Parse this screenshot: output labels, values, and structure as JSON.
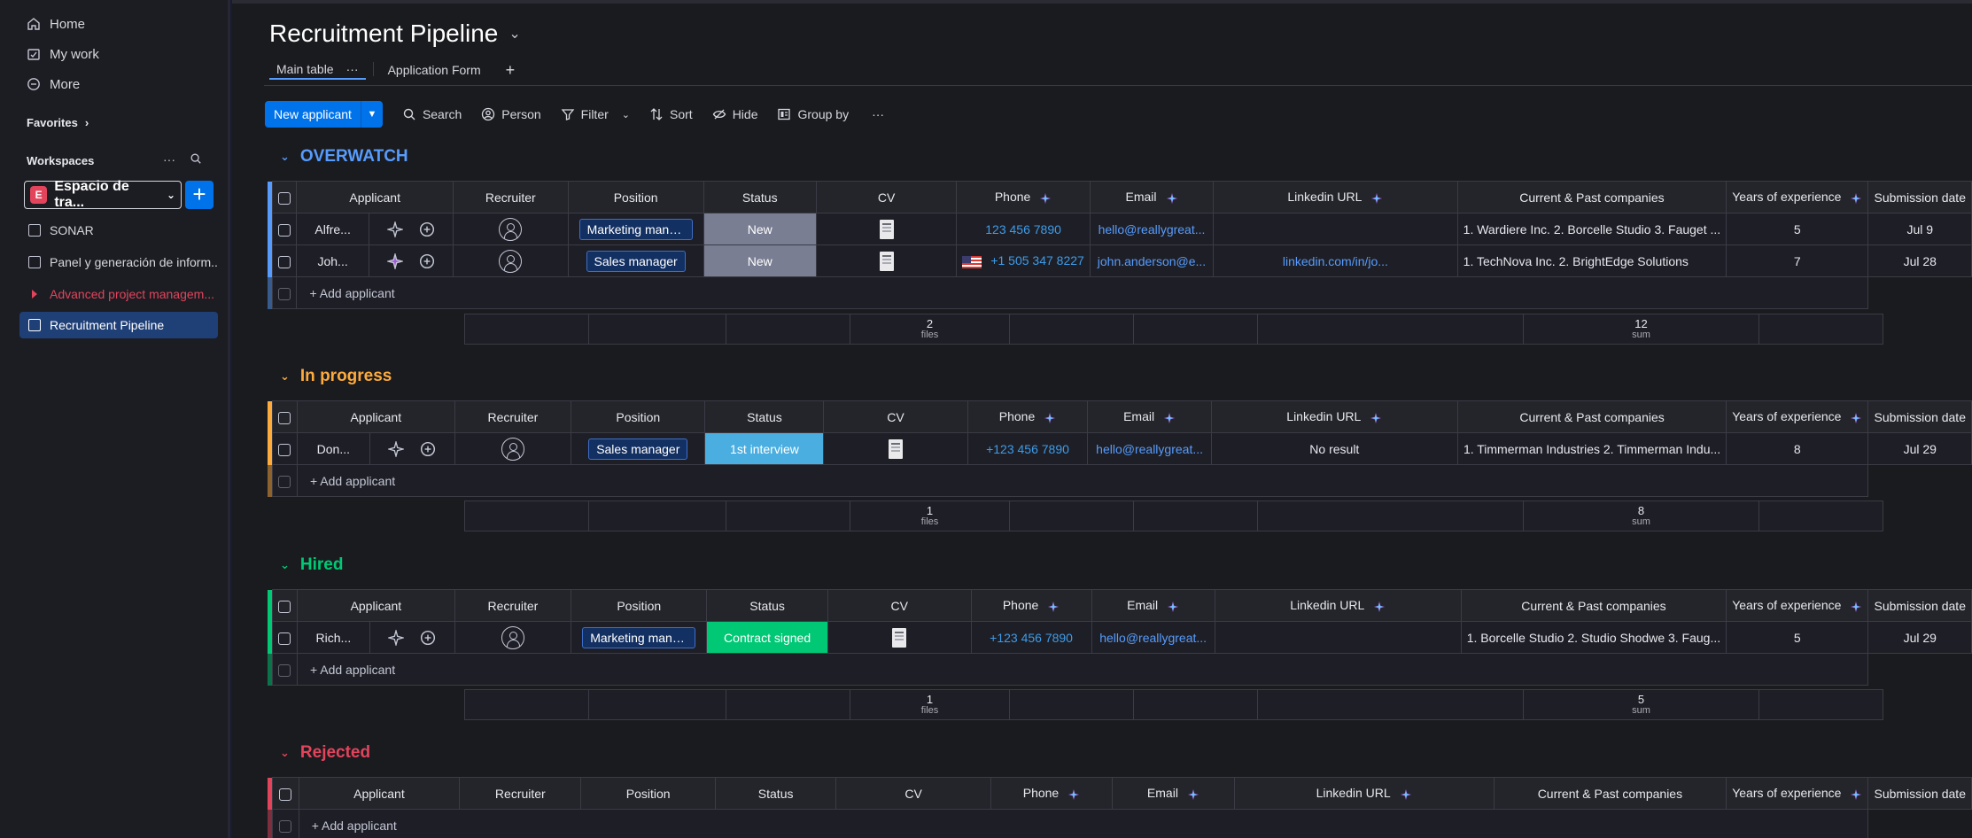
{
  "sidebar": {
    "nav": [
      {
        "label": "Home",
        "icon": "home-icon"
      },
      {
        "label": "My work",
        "icon": "calendar-check-icon"
      },
      {
        "label": "More",
        "icon": "more-circle-icon"
      }
    ],
    "favorites_label": "Favorites",
    "workspaces_label": "Workspaces",
    "workspace_badge": "E",
    "workspace_name": "Espacio de tra...",
    "add_label": "+",
    "boards": [
      {
        "label": "SONAR"
      },
      {
        "label": "Panel y generación de inform..."
      },
      {
        "label": "Advanced project managem..."
      },
      {
        "label": "Recruitment Pipeline"
      }
    ]
  },
  "board": {
    "title": "Recruitment Pipeline",
    "tabs": [
      {
        "label": "Main table",
        "more": "···"
      },
      {
        "label": "Application Form"
      }
    ],
    "add_tab": "+"
  },
  "toolbar": {
    "new_label": "New applicant",
    "search": "Search",
    "person": "Person",
    "filter": "Filter",
    "sort": "Sort",
    "hide": "Hide",
    "group_by": "Group by",
    "more": "···"
  },
  "columns": [
    "Applicant",
    "Recruiter",
    "Position",
    "Status",
    "CV",
    "Phone",
    "Email",
    "Linkedin URL",
    "Current & Past companies",
    "Years of experience",
    "Submission date"
  ],
  "add_row_label": "+ Add applicant",
  "groups": [
    {
      "title": "OVERWATCH",
      "color": "#579bfc",
      "rows": [
        {
          "applicant": "Alfre...",
          "position": "Marketing mana...",
          "status": "New",
          "status_color": "#797e93",
          "phone": "123 456 7890",
          "email": "hello@reallygreat...",
          "linkedin": "",
          "companies": "1. Wardiere Inc. 2. Borcelle Studio 3. Fauget ...",
          "years": "5",
          "date": "Jul 9"
        },
        {
          "applicant": "Joh...",
          "position": "Sales manager",
          "status": "New",
          "status_color": "#797e93",
          "phone": "+1 505 347 8227",
          "email": "john.anderson@e...",
          "linkedin": "linkedin.com/in/jo...",
          "companies": "1. TechNova Inc. 2. BrightEdge Solutions",
          "years": "7",
          "date": "Jul 28"
        }
      ],
      "files_count": "2",
      "files_label": "files",
      "sum_value": "12",
      "sum_label": "sum"
    },
    {
      "title": "In progress",
      "color": "#fdab3d",
      "rows": [
        {
          "applicant": "Don...",
          "position": "Sales manager",
          "status": "1st interview",
          "status_color": "#4aaee0",
          "phone": "+123 456 7890",
          "email": "hello@reallygreat...",
          "linkedin": "No result",
          "companies": "1. Timmerman Industries 2. Timmerman Indu...",
          "years": "8",
          "date": "Jul 29"
        }
      ],
      "files_count": "1",
      "files_label": "files",
      "sum_value": "8",
      "sum_label": "sum"
    },
    {
      "title": "Hired",
      "color": "#00c875",
      "rows": [
        {
          "applicant": "Rich...",
          "position": "Marketing mana...",
          "status": "Contract signed",
          "status_color": "#00c875",
          "phone": "+123 456 7890",
          "email": "hello@reallygreat...",
          "linkedin": "",
          "companies": "1. Borcelle Studio 2. Studio Shodwe 3. Faug...",
          "years": "5",
          "date": "Jul 29"
        }
      ],
      "files_count": "1",
      "files_label": "files",
      "sum_value": "5",
      "sum_label": "sum"
    },
    {
      "title": "Rejected",
      "color": "#e2445c",
      "rows": []
    }
  ]
}
